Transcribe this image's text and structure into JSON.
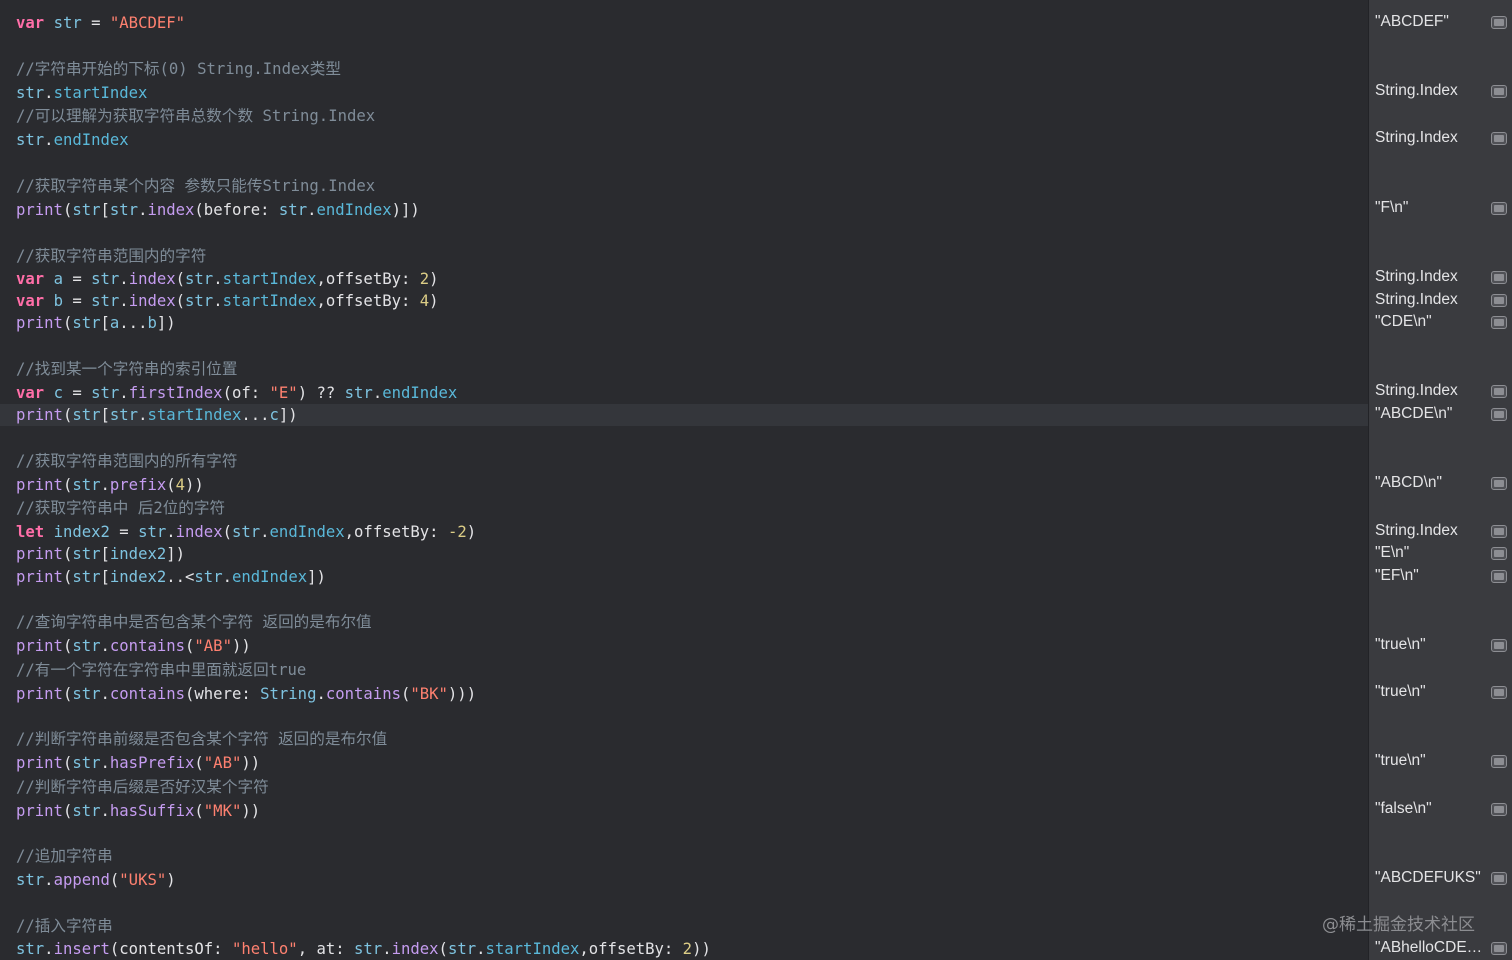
{
  "watermark": "@稀土掘金技术社区",
  "results": [
    {
      "text": "\"ABCDEF\""
    },
    {
      "text": "String.Index"
    },
    {
      "text": "String.Index"
    },
    {
      "text": "\"F\\n\""
    },
    {
      "text": "String.Index"
    },
    {
      "text": "String.Index"
    },
    {
      "text": "\"CDE\\n\""
    },
    {
      "text": "String.Index"
    },
    {
      "text": "\"ABCDE\\n\""
    },
    {
      "text": "\"ABCD\\n\""
    },
    {
      "text": "String.Index"
    },
    {
      "text": "\"E\\n\""
    },
    {
      "text": "\"EF\\n\""
    },
    {
      "text": "\"true\\n\""
    },
    {
      "text": "\"true\\n\""
    },
    {
      "text": "\"true\\n\""
    },
    {
      "text": "\"false\\n\""
    },
    {
      "text": "\"ABCDEFUKS\""
    },
    {
      "text": "\"ABhelloCDEF..."
    }
  ],
  "code": [
    [
      [
        "kw",
        "var"
      ],
      [
        "p",
        " "
      ],
      [
        "var",
        "str"
      ],
      [
        "p",
        " = "
      ],
      [
        "str",
        "\"ABCDEF\""
      ]
    ],
    [
      [
        "cmt",
        "//字符串开始的下标(0) String.Index类型"
      ]
    ],
    [
      [
        "var",
        "str"
      ],
      [
        "p",
        "."
      ],
      [
        "prop",
        "startIndex"
      ]
    ],
    [
      [
        "cmt",
        "//可以理解为获取字符串总数个数 String.Index"
      ]
    ],
    [
      [
        "var",
        "str"
      ],
      [
        "p",
        "."
      ],
      [
        "prop",
        "endIndex"
      ]
    ],
    [
      [
        "cmt",
        "//获取字符串某个内容 参数只能传String.Index"
      ]
    ],
    [
      [
        "fn",
        "print"
      ],
      [
        "p",
        "("
      ],
      [
        "var",
        "str"
      ],
      [
        "p",
        "["
      ],
      [
        "var",
        "str"
      ],
      [
        "p",
        "."
      ],
      [
        "fn",
        "index"
      ],
      [
        "p",
        "(before: "
      ],
      [
        "var",
        "str"
      ],
      [
        "p",
        "."
      ],
      [
        "prop",
        "endIndex"
      ],
      [
        "p",
        ")])"
      ]
    ],
    [
      [
        "cmt",
        "//获取字符串范围内的字符"
      ]
    ],
    [
      [
        "kw",
        "var"
      ],
      [
        "p",
        " "
      ],
      [
        "var",
        "a"
      ],
      [
        "p",
        " = "
      ],
      [
        "var",
        "str"
      ],
      [
        "p",
        "."
      ],
      [
        "fn",
        "index"
      ],
      [
        "p",
        "("
      ],
      [
        "var",
        "str"
      ],
      [
        "p",
        "."
      ],
      [
        "prop",
        "startIndex"
      ],
      [
        "p",
        ",offsetBy: "
      ],
      [
        "num",
        "2"
      ],
      [
        "p",
        ")"
      ]
    ],
    [
      [
        "kw",
        "var"
      ],
      [
        "p",
        " "
      ],
      [
        "var",
        "b"
      ],
      [
        "p",
        " = "
      ],
      [
        "var",
        "str"
      ],
      [
        "p",
        "."
      ],
      [
        "fn",
        "index"
      ],
      [
        "p",
        "("
      ],
      [
        "var",
        "str"
      ],
      [
        "p",
        "."
      ],
      [
        "prop",
        "startIndex"
      ],
      [
        "p",
        ",offsetBy: "
      ],
      [
        "num",
        "4"
      ],
      [
        "p",
        ")"
      ]
    ],
    [
      [
        "fn",
        "print"
      ],
      [
        "p",
        "("
      ],
      [
        "var",
        "str"
      ],
      [
        "p",
        "["
      ],
      [
        "var",
        "a"
      ],
      [
        "p",
        "..."
      ],
      [
        "var",
        "b"
      ],
      [
        "p",
        "])"
      ]
    ],
    [
      [
        "cmt",
        "//找到某一个字符串的索引位置"
      ]
    ],
    [
      [
        "kw",
        "var"
      ],
      [
        "p",
        " "
      ],
      [
        "var",
        "c"
      ],
      [
        "p",
        " = "
      ],
      [
        "var",
        "str"
      ],
      [
        "p",
        "."
      ],
      [
        "fn",
        "firstIndex"
      ],
      [
        "p",
        "(of: "
      ],
      [
        "str",
        "\"E\""
      ],
      [
        "p",
        ") ?? "
      ],
      [
        "var",
        "str"
      ],
      [
        "p",
        "."
      ],
      [
        "prop",
        "endIndex"
      ]
    ],
    [
      [
        "fn",
        "print"
      ],
      [
        "p",
        "("
      ],
      [
        "var",
        "str"
      ],
      [
        "p",
        "["
      ],
      [
        "var",
        "str"
      ],
      [
        "p",
        "."
      ],
      [
        "prop",
        "startIndex"
      ],
      [
        "p",
        "..."
      ],
      [
        "var",
        "c"
      ],
      [
        "p",
        "])"
      ]
    ],
    [
      [
        "cmt",
        "//获取字符串范围内的所有字符"
      ]
    ],
    [
      [
        "fn",
        "print"
      ],
      [
        "p",
        "("
      ],
      [
        "var",
        "str"
      ],
      [
        "p",
        "."
      ],
      [
        "fn",
        "prefix"
      ],
      [
        "p",
        "("
      ],
      [
        "num",
        "4"
      ],
      [
        "p",
        "))"
      ]
    ],
    [
      [
        "cmt",
        "//获取字符串中 后2位的字符"
      ]
    ],
    [
      [
        "kw",
        "let"
      ],
      [
        "p",
        " "
      ],
      [
        "var",
        "index2"
      ],
      [
        "p",
        " = "
      ],
      [
        "var",
        "str"
      ],
      [
        "p",
        "."
      ],
      [
        "fn",
        "index"
      ],
      [
        "p",
        "("
      ],
      [
        "var",
        "str"
      ],
      [
        "p",
        "."
      ],
      [
        "prop",
        "endIndex"
      ],
      [
        "p",
        ",offsetBy: "
      ],
      [
        "num",
        "-2"
      ],
      [
        "p",
        ")"
      ]
    ],
    [
      [
        "fn",
        "print"
      ],
      [
        "p",
        "("
      ],
      [
        "var",
        "str"
      ],
      [
        "p",
        "["
      ],
      [
        "var",
        "index2"
      ],
      [
        "p",
        "])"
      ]
    ],
    [
      [
        "fn",
        "print"
      ],
      [
        "p",
        "("
      ],
      [
        "var",
        "str"
      ],
      [
        "p",
        "["
      ],
      [
        "var",
        "index2"
      ],
      [
        "p",
        "..<"
      ],
      [
        "var",
        "str"
      ],
      [
        "p",
        "."
      ],
      [
        "prop",
        "endIndex"
      ],
      [
        "p",
        "])"
      ]
    ],
    [
      [
        "cmt",
        "//查询字符串中是否包含某个字符 返回的是布尔值"
      ]
    ],
    [
      [
        "fn",
        "print"
      ],
      [
        "p",
        "("
      ],
      [
        "var",
        "str"
      ],
      [
        "p",
        "."
      ],
      [
        "fn",
        "contains"
      ],
      [
        "p",
        "("
      ],
      [
        "str",
        "\"AB\""
      ],
      [
        "p",
        "))"
      ]
    ],
    [
      [
        "cmt",
        "//有一个字符在字符串中里面就返回true"
      ]
    ],
    [
      [
        "fn",
        "print"
      ],
      [
        "p",
        "("
      ],
      [
        "var",
        "str"
      ],
      [
        "p",
        "."
      ],
      [
        "fn",
        "contains"
      ],
      [
        "p",
        "(where: "
      ],
      [
        "var",
        "String"
      ],
      [
        "p",
        "."
      ],
      [
        "fn",
        "contains"
      ],
      [
        "p",
        "("
      ],
      [
        "str",
        "\"BK\""
      ],
      [
        "p",
        ")))"
      ]
    ],
    [
      [
        "cmt",
        "//判断字符串前缀是否包含某个字符 返回的是布尔值"
      ]
    ],
    [
      [
        "fn",
        "print"
      ],
      [
        "p",
        "("
      ],
      [
        "var",
        "str"
      ],
      [
        "p",
        "."
      ],
      [
        "fn",
        "hasPrefix"
      ],
      [
        "p",
        "("
      ],
      [
        "str",
        "\"AB\""
      ],
      [
        "p",
        "))"
      ]
    ],
    [
      [
        "cmt",
        "//判断字符串后缀是否好汉某个字符"
      ]
    ],
    [
      [
        "fn",
        "print"
      ],
      [
        "p",
        "("
      ],
      [
        "var",
        "str"
      ],
      [
        "p",
        "."
      ],
      [
        "fn",
        "hasSuffix"
      ],
      [
        "p",
        "("
      ],
      [
        "str",
        "\"MK\""
      ],
      [
        "p",
        "))"
      ]
    ],
    [
      [
        "cmt",
        "//追加字符串"
      ]
    ],
    [
      [
        "var",
        "str"
      ],
      [
        "p",
        "."
      ],
      [
        "fn",
        "append"
      ],
      [
        "p",
        "("
      ],
      [
        "str",
        "\"UKS\""
      ],
      [
        "p",
        ")"
      ]
    ],
    [
      [
        "cmt",
        "//插入字符串"
      ]
    ],
    [
      [
        "var",
        "str"
      ],
      [
        "p",
        "."
      ],
      [
        "fn",
        "insert"
      ],
      [
        "p",
        "(contentsOf: "
      ],
      [
        "str",
        "\"hello\""
      ],
      [
        "p",
        ", at: "
      ],
      [
        "var",
        "str"
      ],
      [
        "p",
        "."
      ],
      [
        "fn",
        "index"
      ],
      [
        "p",
        "("
      ],
      [
        "var",
        "str"
      ],
      [
        "p",
        "."
      ],
      [
        "prop",
        "startIndex"
      ],
      [
        "p",
        ",offsetBy: "
      ],
      [
        "num",
        "2"
      ],
      [
        "p",
        "))"
      ]
    ]
  ]
}
